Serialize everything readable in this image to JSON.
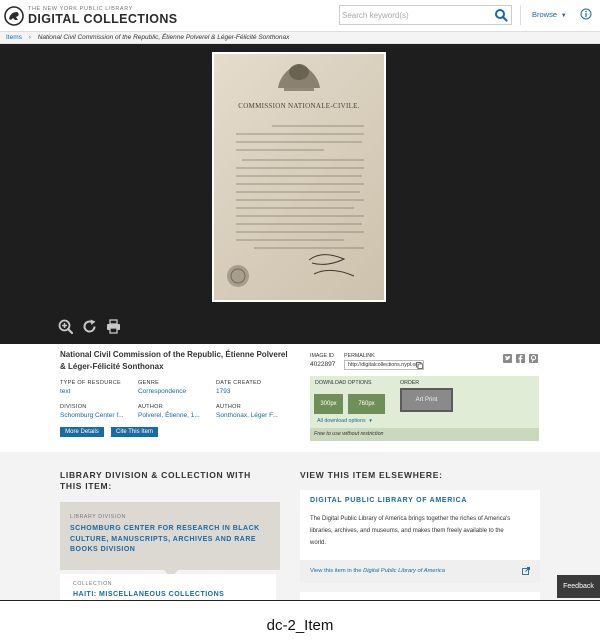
{
  "header": {
    "logo_small": "THE NEW YORK PUBLIC LIBRARY",
    "logo_big": "DIGITAL COLLECTIONS",
    "search_placeholder": "Search keyword(s)",
    "search_value": "",
    "browse_label": "Browse"
  },
  "breadcrumb": {
    "items_label": "Items",
    "current": "National Civil Commission of the Republic, Étienne Polverel & Léger-Félicité Sonthonax"
  },
  "viewer": {
    "document_heading": "COMMISSION NATIONALE-CIVILE."
  },
  "item": {
    "title": "National Civil Commission of the Republic, Étienne Polverel & Léger-Félicité Sonthonax",
    "image_id_label": "IMAGE ID",
    "image_id": "4022897",
    "permalink_label": "PERMALINK",
    "permalink": "http://digitalcollections.nypl.org",
    "metadata": {
      "type_label": "TYPE OF RESOURCE",
      "type_value": "text",
      "genre_label": "GENRE",
      "genre_value": "Correspondence",
      "date_label": "DATE CREATED",
      "date_value": "1793",
      "division_label": "DIVISION",
      "division_value": "Schomburg Center f...",
      "author1_label": "AUTHOR",
      "author1_value": "Polverel, Étienne, 1...",
      "author2_label": "AUTHOR",
      "author2_value": "Sonthonax, Léger F..."
    },
    "more_details": "More Details",
    "cite_item": "Cite This Item"
  },
  "download": {
    "options_label": "DOWNLOAD OPTIONS",
    "order_label": "ORDER",
    "size1": "300px",
    "size2": "760px",
    "all_options": "All download options",
    "art_print": "Art Print",
    "free_text": "Free to use without restriction"
  },
  "division_section": {
    "title": "LIBRARY DIVISION & COLLECTION WITH THIS ITEM:",
    "division_label": "LIBRARY DIVISION",
    "division_name": "SCHOMBURG CENTER FOR RESEARCH IN BLACK CULTURE, MANUSCRIPTS, ARCHIVES AND RARE BOOKS DIVISION",
    "collection_label": "COLLECTION",
    "collection_name": "HAITI: MISCELLANEOUS COLLECTIONS"
  },
  "elsewhere": {
    "title": "VIEW THIS ITEM ELSEWHERE:",
    "dpla_title": "DIGITAL PUBLIC LIBRARY OF AMERICA",
    "dpla_desc": "The Digital Public Library of America brings together the riches of America's libraries, archives, and museums, and makes them freely available to the world.",
    "dpla_link_prefix": "View this item in the ",
    "dpla_link_name": "Digital Public Library of America"
  },
  "feedback_label": "Feedback",
  "caption": "dc-2_Item",
  "colors": {
    "link_blue": "#1a6aa3",
    "viewer_bg": "#1e1e1e",
    "download_green": "#e1ecd6",
    "download_button": "#6f8f58",
    "art_print_gray": "#8a8a8a"
  }
}
